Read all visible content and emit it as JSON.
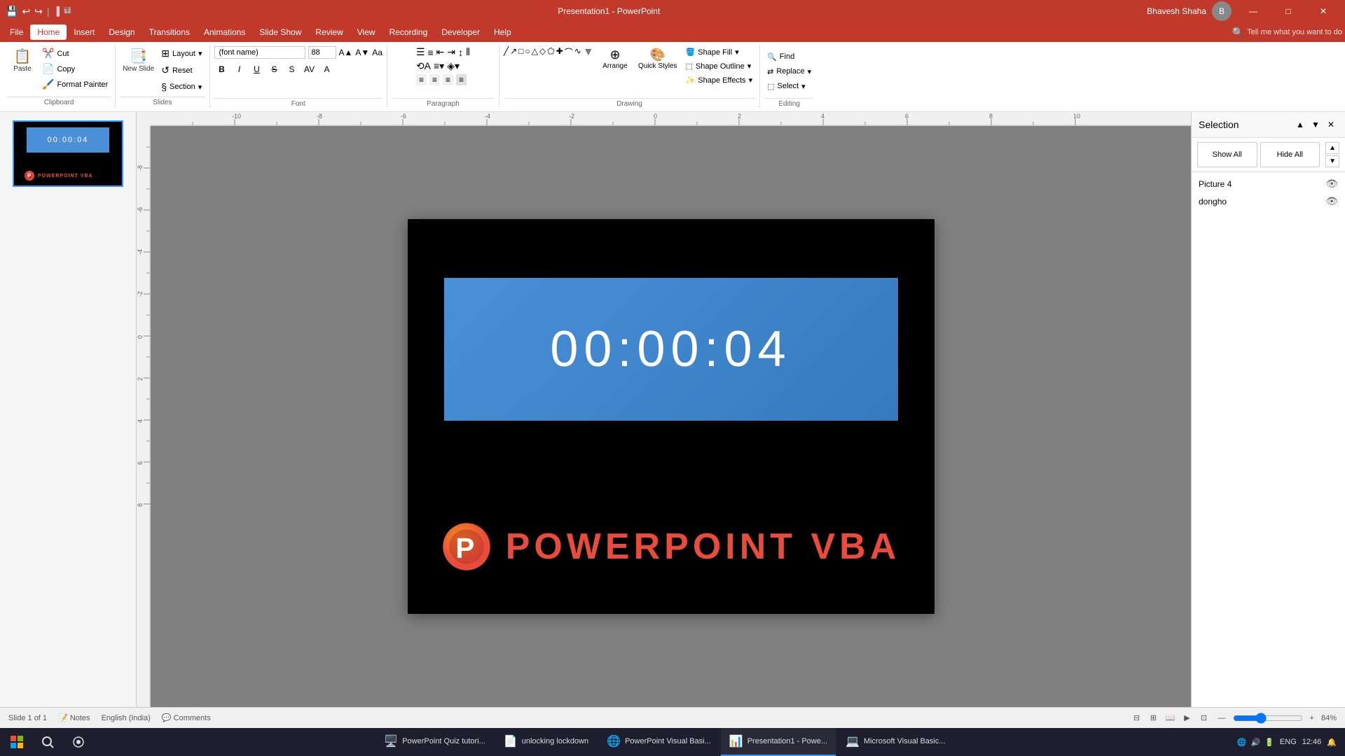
{
  "titlebar": {
    "title": "Presentation1 - PowerPoint",
    "user": "Bhavesh Shaha",
    "buttons": {
      "minimize": "—",
      "maximize": "□",
      "close": "✕"
    }
  },
  "menubar": {
    "items": [
      "File",
      "Home",
      "Insert",
      "Design",
      "Transitions",
      "Animations",
      "Slide Show",
      "Review",
      "View",
      "Recording",
      "Developer",
      "Help"
    ],
    "active": "Home",
    "search_placeholder": "Tell me what you want to do"
  },
  "ribbon": {
    "clipboard": {
      "label": "Clipboard",
      "paste": "Paste",
      "cut": "Cut",
      "copy": "Copy",
      "format_painter": "Format Painter"
    },
    "slides": {
      "label": "Slides",
      "new_slide": "New\nSlide",
      "layout": "Layout",
      "reset": "Reset",
      "section": "Section"
    },
    "font": {
      "label": "Font",
      "font_name": "(font name)",
      "size": "88",
      "bold": "B",
      "italic": "I",
      "underline": "U",
      "strikethrough": "S"
    },
    "paragraph": {
      "label": "Paragraph"
    },
    "drawing": {
      "label": "Drawing",
      "arrange": "Arrange",
      "quick_styles": "Quick\nStyles",
      "shape_fill": "Shape Fill",
      "shape_outline": "Shape Outline",
      "shape_effects": "Shape Effects"
    },
    "editing": {
      "label": "Editing",
      "find": "Find",
      "replace": "Replace",
      "select": "Select"
    }
  },
  "slide": {
    "number": "1",
    "timer_text": "00:00:04",
    "vba_label": "POWERPOINT VBA",
    "thumbnail_timer": "00:00:04",
    "thumbnail_vba": "POWERPOINT VBA"
  },
  "selection_panel": {
    "title": "Selection",
    "show_all": "Show All",
    "hide_all": "Hide All",
    "items": [
      {
        "name": "Picture 4",
        "visible": true
      },
      {
        "name": "dongho",
        "visible": true
      }
    ]
  },
  "statusbar": {
    "slide_info": "Slide 1 of 1",
    "language": "English (India)",
    "notes": "Notes",
    "comments": "Comments",
    "zoom": "84%",
    "zoom_value": 84
  },
  "taskbar": {
    "apps": [
      {
        "label": "PowerPoint Quiz tutori...",
        "icon": "🖥️",
        "active": false
      },
      {
        "label": "unlocking lockdown",
        "icon": "📄",
        "active": false
      },
      {
        "label": "PowerPoint Visual Basi...",
        "icon": "🌐",
        "active": false
      },
      {
        "label": "Presentation1 - Powe...",
        "icon": "📊",
        "active": true
      },
      {
        "label": "Microsoft Visual Basic...",
        "icon": "💻",
        "active": false
      }
    ],
    "time": "12:46",
    "date": "ENG"
  }
}
